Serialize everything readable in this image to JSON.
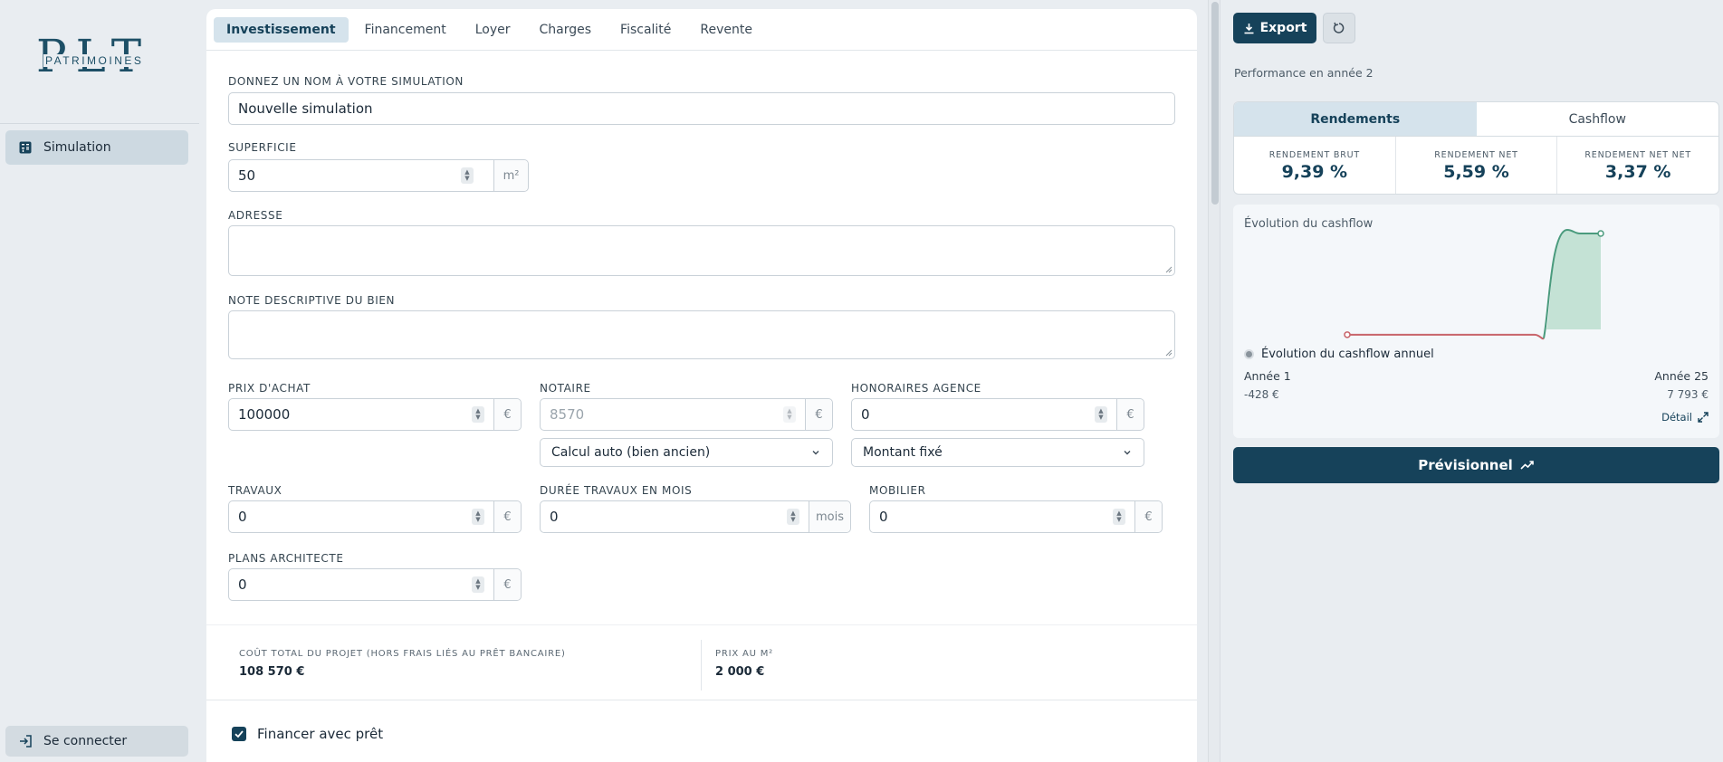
{
  "app": {
    "logo_letters": "PLT",
    "logo_sub": "PATRIMOINES"
  },
  "sidebar": {
    "items": [
      {
        "label": "Simulation",
        "icon": "calculator-icon"
      }
    ],
    "login_label": "Se connecter"
  },
  "tabs": [
    {
      "label": "Investissement"
    },
    {
      "label": "Financement"
    },
    {
      "label": "Loyer"
    },
    {
      "label": "Charges"
    },
    {
      "label": "Fiscalité"
    },
    {
      "label": "Revente"
    }
  ],
  "form": {
    "name_label": "Donnez un nom à votre simulation",
    "name_value": "Nouvelle simulation",
    "surface_label": "Superficie",
    "surface_value": "50",
    "surface_unit": "m²",
    "address_label": "Adresse",
    "note_label": "Note descriptive du bien",
    "price_label": "Prix d'achat",
    "price_value": "100000",
    "notary_label": "Notaire",
    "notary_value": "8570",
    "notary_mode": "Calcul auto (bien ancien)",
    "agency_label": "Honoraires agence",
    "agency_value": "0",
    "agency_mode": "Montant fixé",
    "works_label": "Travaux",
    "works_value": "0",
    "works_duration_label": "Durée travaux en mois",
    "works_duration_value": "0",
    "works_duration_unit": "mois",
    "furniture_label": "Mobilier",
    "furniture_value": "0",
    "architect_label": "Plans architecte",
    "architect_value": "0",
    "currency": "€"
  },
  "totals": {
    "total_label": "Coût total du projet (hors frais liés au prêt bancaire)",
    "total_value": "108 570 €",
    "price_m2_label": "Prix au m²",
    "price_m2_value": "2 000 €"
  },
  "loan_checkbox": {
    "label": "Financer avec prêt",
    "checked": true
  },
  "right": {
    "export_label": "Export",
    "performance_label": "Performance en année 2",
    "tabs": [
      {
        "label": "Rendements"
      },
      {
        "label": "Cashflow"
      }
    ],
    "metrics": [
      {
        "label": "Rendement brut",
        "value": "9,39 %"
      },
      {
        "label": "Rendement net",
        "value": "5,59 %"
      },
      {
        "label": "Rendement net net",
        "value": "3,37 %"
      }
    ],
    "chart_title": "Évolution du cashflow",
    "legend": "Évolution du cashflow annuel",
    "start_year": "Année 1",
    "end_year": "Année 25",
    "start_value": "-428 €",
    "end_value": "7 793 €",
    "detail_label": "Détail",
    "previsionnel_label": "Prévisionnel"
  },
  "chart_data": {
    "type": "line",
    "series": [
      {
        "name": "Évolution du cashflow annuel",
        "x": [
          1,
          25
        ],
        "y": [
          -428,
          7793
        ]
      }
    ]
  },
  "colors": {
    "primary": "#16425a",
    "positive": "#4a9b7d",
    "negative": "#c8646a"
  }
}
